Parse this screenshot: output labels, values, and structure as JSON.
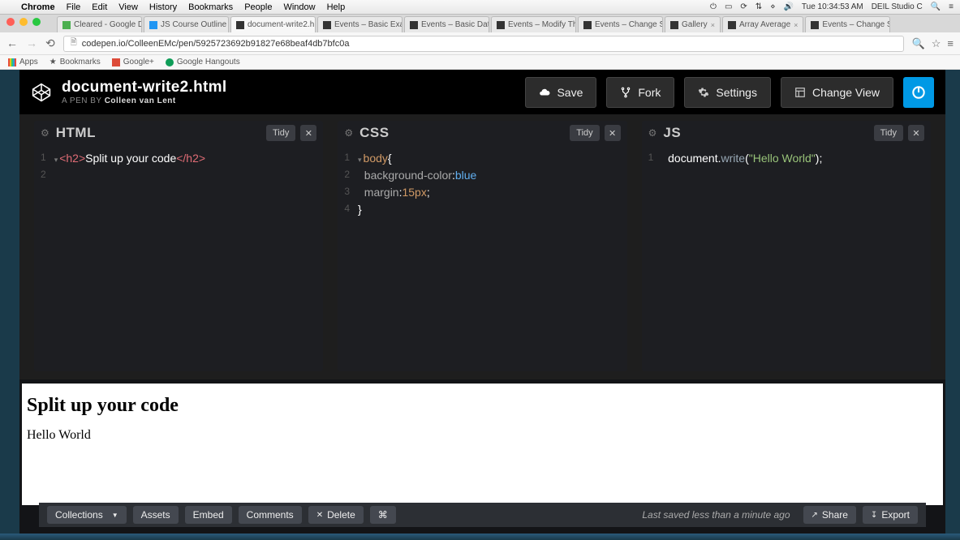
{
  "mac_menu": {
    "app": "Chrome",
    "items": [
      "File",
      "Edit",
      "View",
      "History",
      "Bookmarks",
      "People",
      "Window",
      "Help"
    ],
    "time": "Tue 10:34:53 AM",
    "user": "DEIL Studio C"
  },
  "browser": {
    "tabs": [
      {
        "label": "Cleared - Google D…"
      },
      {
        "label": "JS Course Outline …"
      },
      {
        "label": "document-write2.h…",
        "active": true
      },
      {
        "label": "Events – Basic Exa…"
      },
      {
        "label": "Events – Basic Date…"
      },
      {
        "label": "Events – Modify The…"
      },
      {
        "label": "Events – Change Style…"
      },
      {
        "label": "Gallery"
      },
      {
        "label": "Array Average"
      },
      {
        "label": "Events – Change Style…"
      }
    ],
    "url": "codepen.io/ColleenEMc/pen/5925723692b91827e68beaf4db7bfc0a",
    "bookmarks": [
      "Apps",
      "Bookmarks",
      "Google+",
      "Google Hangouts"
    ]
  },
  "codepen": {
    "title": "document-write2.html",
    "subtitle_prefix": "A PEN BY ",
    "author": "Colleen van Lent",
    "buttons": {
      "save": "Save",
      "fork": "Fork",
      "settings": "Settings",
      "changeview": "Change View"
    }
  },
  "panes": {
    "html": {
      "title": "HTML",
      "tidy": "Tidy"
    },
    "css": {
      "title": "CSS",
      "tidy": "Tidy"
    },
    "js": {
      "title": "JS",
      "tidy": "Tidy"
    }
  },
  "code": {
    "html": {
      "open_tag": "<h2>",
      "text": "Split up your code",
      "close_tag": "</h2>"
    },
    "css": {
      "selector": "body",
      "open": "{",
      "prop1": "background-color",
      "val1": "blue",
      "prop2": "margin",
      "val2": "15px",
      "semi": ";",
      "close": "}"
    },
    "js": {
      "obj": "document",
      "dot": ".",
      "meth": "write",
      "open": "(",
      "str": "\"Hello World\"",
      "close": ")",
      "semi": ";"
    }
  },
  "output": {
    "heading": "Split up your code",
    "text": "Hello World"
  },
  "footer": {
    "collections": "Collections",
    "assets": "Assets",
    "embed": "Embed",
    "comments": "Comments",
    "delete": "Delete",
    "cmd": "⌘",
    "status": "Last saved less than a minute ago",
    "share": "Share",
    "export": "Export"
  }
}
